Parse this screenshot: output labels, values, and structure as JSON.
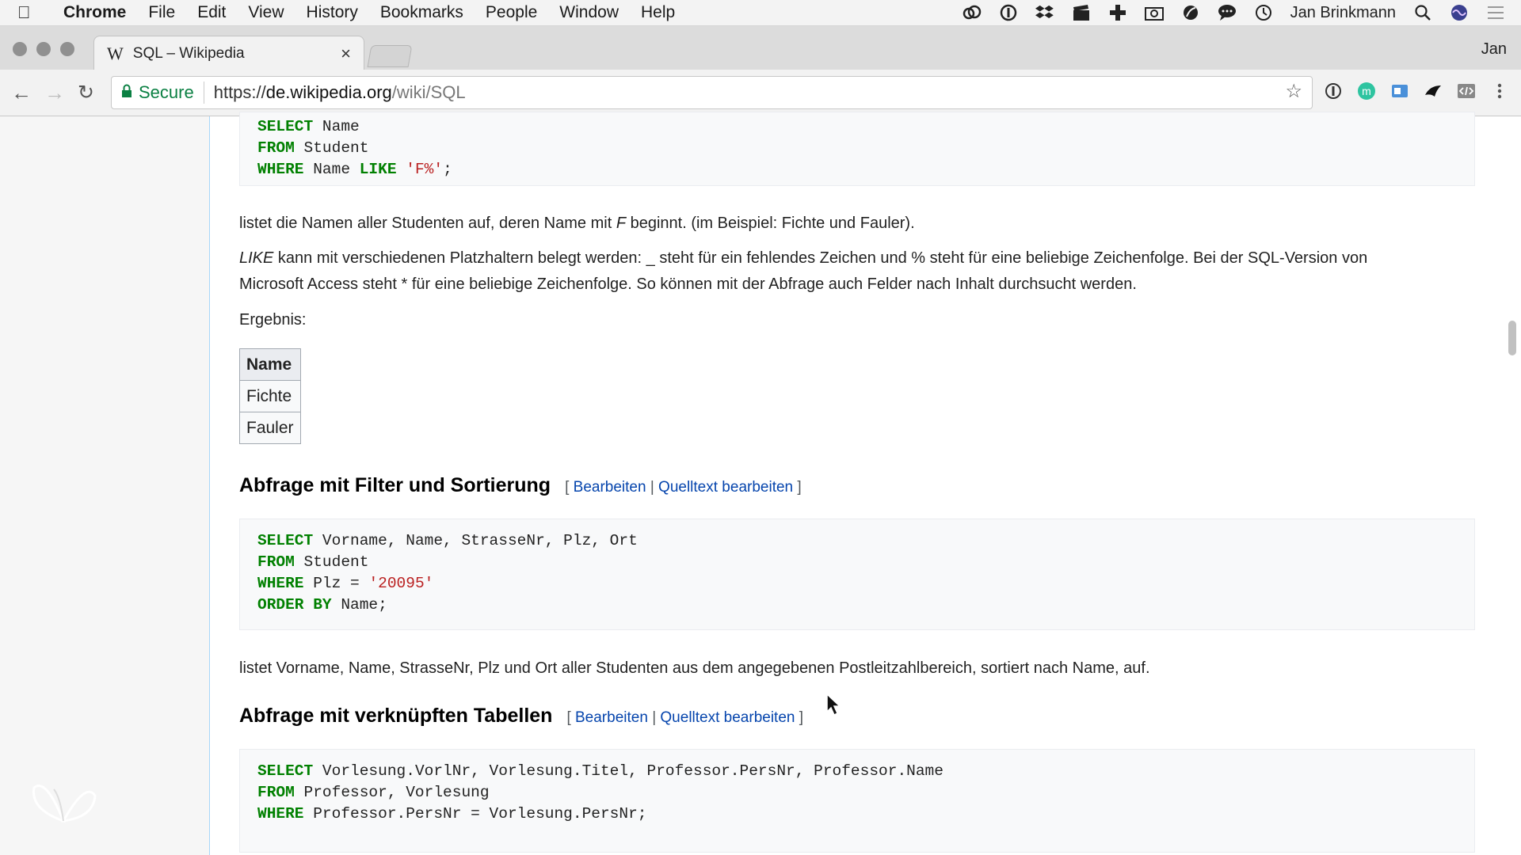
{
  "menubar": {
    "app": "Chrome",
    "items": [
      "File",
      "Edit",
      "View",
      "History",
      "Bookmarks",
      "People",
      "Window",
      "Help"
    ],
    "user": "Jan Brinkmann"
  },
  "tab": {
    "favicon": "W",
    "title": "SQL – Wikipedia",
    "close": "×"
  },
  "profile_name": "Jan",
  "address": {
    "secure_label": "Secure",
    "scheme": "https://",
    "host": "de.wikipedia.org",
    "path": "/wiki/SQL"
  },
  "article": {
    "code1": [
      [
        {
          "t": "SELECT",
          "c": "kw"
        },
        {
          "t": " Name"
        }
      ],
      [
        {
          "t": "FROM",
          "c": "kw"
        },
        {
          "t": " Student"
        }
      ],
      [
        {
          "t": "WHERE",
          "c": "kw"
        },
        {
          "t": " Name "
        },
        {
          "t": "LIKE",
          "c": "kw"
        },
        {
          "t": " "
        },
        {
          "t": "'F%'",
          "c": "str"
        },
        {
          "t": ";"
        }
      ]
    ],
    "p1_before": "listet die Namen aller Studenten auf, deren Name mit ",
    "p1_italic": "F",
    "p1_after": " beginnt. (im Beispiel: Fichte und Fauler).",
    "p2_italic": "LIKE",
    "p2_line1": " kann mit verschiedenen Platzhaltern belegt werden: _ steht für ein fehlendes Zeichen und % steht für eine beliebige Zeichenfolge. Bei der SQL-Version von",
    "p2_line2": "Microsoft Access steht * für eine beliebige Zeichenfolge. So können mit der Abfrage auch Felder nach Inhalt durchsucht werden.",
    "result_label": "Ergebnis:",
    "result_table": {
      "header": "Name",
      "rows": [
        "Fichte",
        "Fauler"
      ]
    },
    "h1": "Abfrage mit Filter und Sortierung",
    "h2": "Abfrage mit verknüpften Tabellen",
    "edit_label": "Bearbeiten",
    "source_edit_label": "Quelltext bearbeiten",
    "bracket_open": "[",
    "bracket_close": "]",
    "pipe": "|",
    "code2": [
      [
        {
          "t": "SELECT",
          "c": "kw"
        },
        {
          "t": " Vorname, Name, StrasseNr, Plz, Ort"
        }
      ],
      [
        {
          "t": "FROM",
          "c": "kw"
        },
        {
          "t": " Student"
        }
      ],
      [
        {
          "t": "WHERE",
          "c": "kw"
        },
        {
          "t": " Plz = "
        },
        {
          "t": "'20095'",
          "c": "str"
        }
      ],
      [
        {
          "t": "ORDER BY",
          "c": "kw"
        },
        {
          "t": " Name;"
        }
      ]
    ],
    "p3": "listet Vorname, Name, StrasseNr, Plz und Ort aller Studenten aus dem angegebenen Postleitzahlbereich, sortiert nach Name, auf.",
    "code3": [
      [
        {
          "t": "SELECT",
          "c": "kw"
        },
        {
          "t": " Vorlesung.VorlNr, Vorlesung.Titel, Professor.PersNr, Professor.Name"
        }
      ],
      [
        {
          "t": "FROM",
          "c": "kw"
        },
        {
          "t": " Professor, Vorlesung"
        }
      ],
      [
        {
          "t": "WHERE",
          "c": "kw"
        },
        {
          "t": " Professor.PersNr = Vorlesung.PersNr;"
        }
      ]
    ]
  },
  "colors": {
    "keyword": "#008000",
    "string": "#ba2121",
    "link": "#0645ad",
    "secure": "#0b8043"
  }
}
